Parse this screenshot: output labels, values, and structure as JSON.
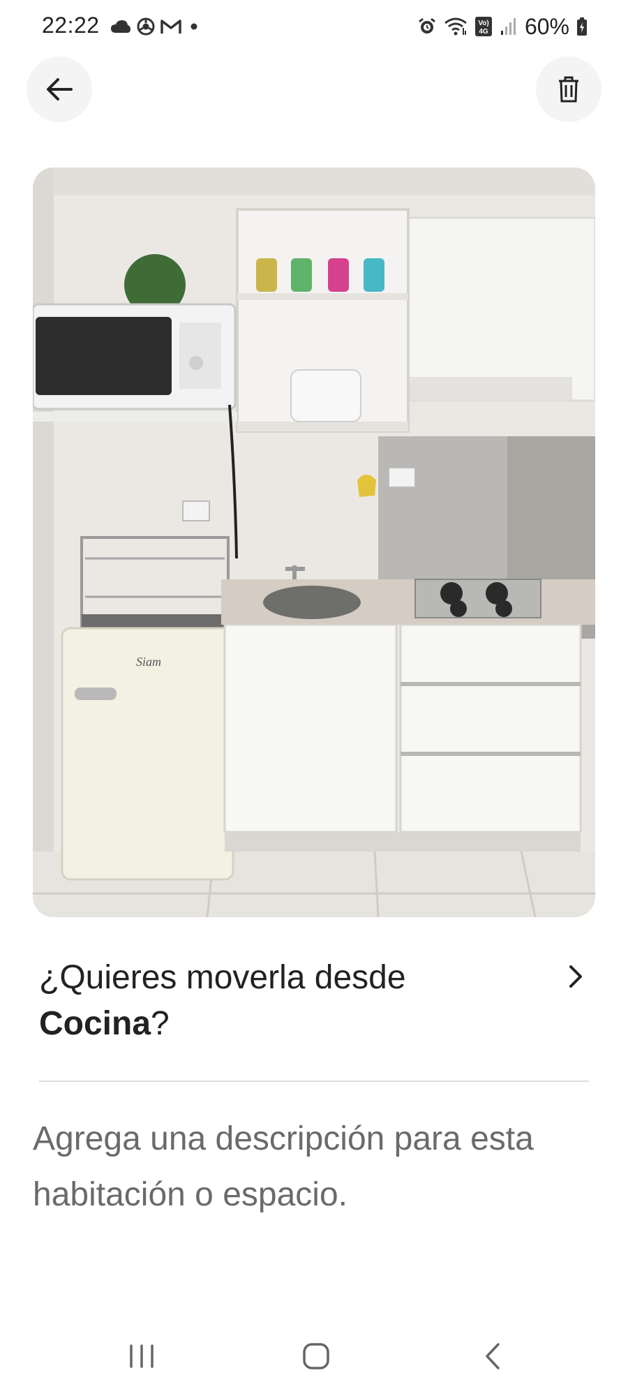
{
  "status_bar": {
    "time": "22:22",
    "left_icons": [
      "cloud-icon",
      "chrome-icon",
      "gmail-icon",
      "dot-icon"
    ],
    "right_icons": [
      "alarm-icon",
      "wifi-icon",
      "volte-icon",
      "signal-icon",
      "battery-icon"
    ],
    "volte_label_top": "Vo)",
    "volte_label_bottom": "4G",
    "battery": "60%"
  },
  "header": {
    "back_icon": "arrow-left-icon",
    "delete_icon": "trash-icon"
  },
  "photo": {
    "alt": "Kitchen photo",
    "fridge_brand": "Siam"
  },
  "move": {
    "question_prefix": "¿Quieres moverla desde",
    "room_name": "Cocina",
    "question_suffix": "?",
    "chevron_icon": "chevron-right-icon"
  },
  "description": {
    "placeholder": "Agrega una descripción para esta habitación o espacio."
  },
  "navigation_bar": {
    "recents_icon": "recents-icon",
    "home_icon": "home-icon",
    "back_icon": "back-icon"
  },
  "colors": {
    "text_primary": "#222222",
    "text_secondary": "#6a6a6a",
    "button_bg": "#f4f4f4",
    "divider": "#dddddd"
  }
}
